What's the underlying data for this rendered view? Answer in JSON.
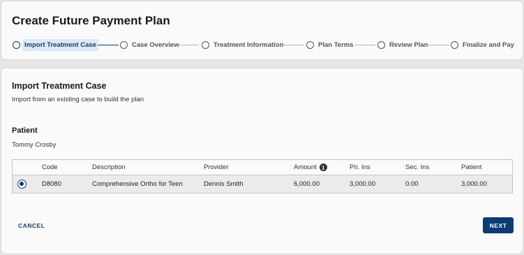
{
  "header": {
    "title": "Create Future Payment Plan"
  },
  "stepper": {
    "steps": [
      {
        "label": "Import Treatment Case",
        "active": true
      },
      {
        "label": "Case Overview",
        "active": false
      },
      {
        "label": "Treatment Information",
        "active": false
      },
      {
        "label": "Plan Terms",
        "active": false
      },
      {
        "label": "Review Plan",
        "active": false
      },
      {
        "label": "Finalize and Pay",
        "active": false
      }
    ]
  },
  "section": {
    "title": "Import Treatment Case",
    "subtitle": "Import from an existing case to build the plan"
  },
  "patient": {
    "label": "Patient",
    "name": "Tommy Crosby"
  },
  "table": {
    "columns": [
      "Code",
      "Description",
      "Provider",
      "Amount",
      "Pri. Ins",
      "Sec. Ins",
      "Patient"
    ],
    "rows": [
      {
        "selected": true,
        "code": "D8080",
        "description": "Comprehensive Ortho for Teen",
        "provider": "Dennis Smith",
        "amount": "6,000.00",
        "pri_ins": "3,000.00",
        "sec_ins": "0.00",
        "patient": "3,000.00"
      }
    ],
    "info_icon": "i"
  },
  "actions": {
    "cancel_label": "CANCEL",
    "next_label": "NEXT"
  },
  "colors": {
    "primary": "#0d3b72",
    "active_step_bg": "#dbe9f8"
  }
}
